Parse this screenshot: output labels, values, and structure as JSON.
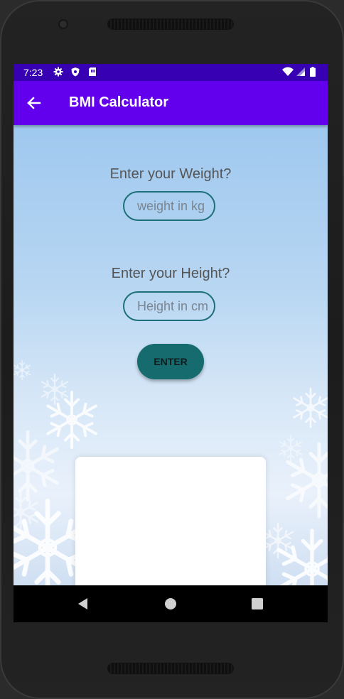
{
  "status_bar": {
    "time": "7:23",
    "left_icons": [
      "settings-icon",
      "shield-icon",
      "sim-card-icon"
    ],
    "right_icons": [
      "wifi-icon",
      "signal-icon",
      "battery-icon"
    ]
  },
  "app_bar": {
    "title": "BMI Calculator",
    "nav_icon": "back-arrow-icon"
  },
  "form": {
    "weight_label": "Enter your Weight?",
    "weight_placeholder": "weight in kg",
    "height_label": "Enter your Height?",
    "height_placeholder": "Height in cm",
    "enter_button": "ENTER"
  },
  "result_card": {
    "content": ""
  },
  "nav_bar": {
    "buttons": [
      "back-triangle-icon",
      "home-circle-icon",
      "recents-square-icon"
    ]
  },
  "colors": {
    "status_bar": "#3700b3",
    "app_bar": "#6200ee",
    "field_border": "#1d6f78",
    "button": "#156b6e"
  }
}
